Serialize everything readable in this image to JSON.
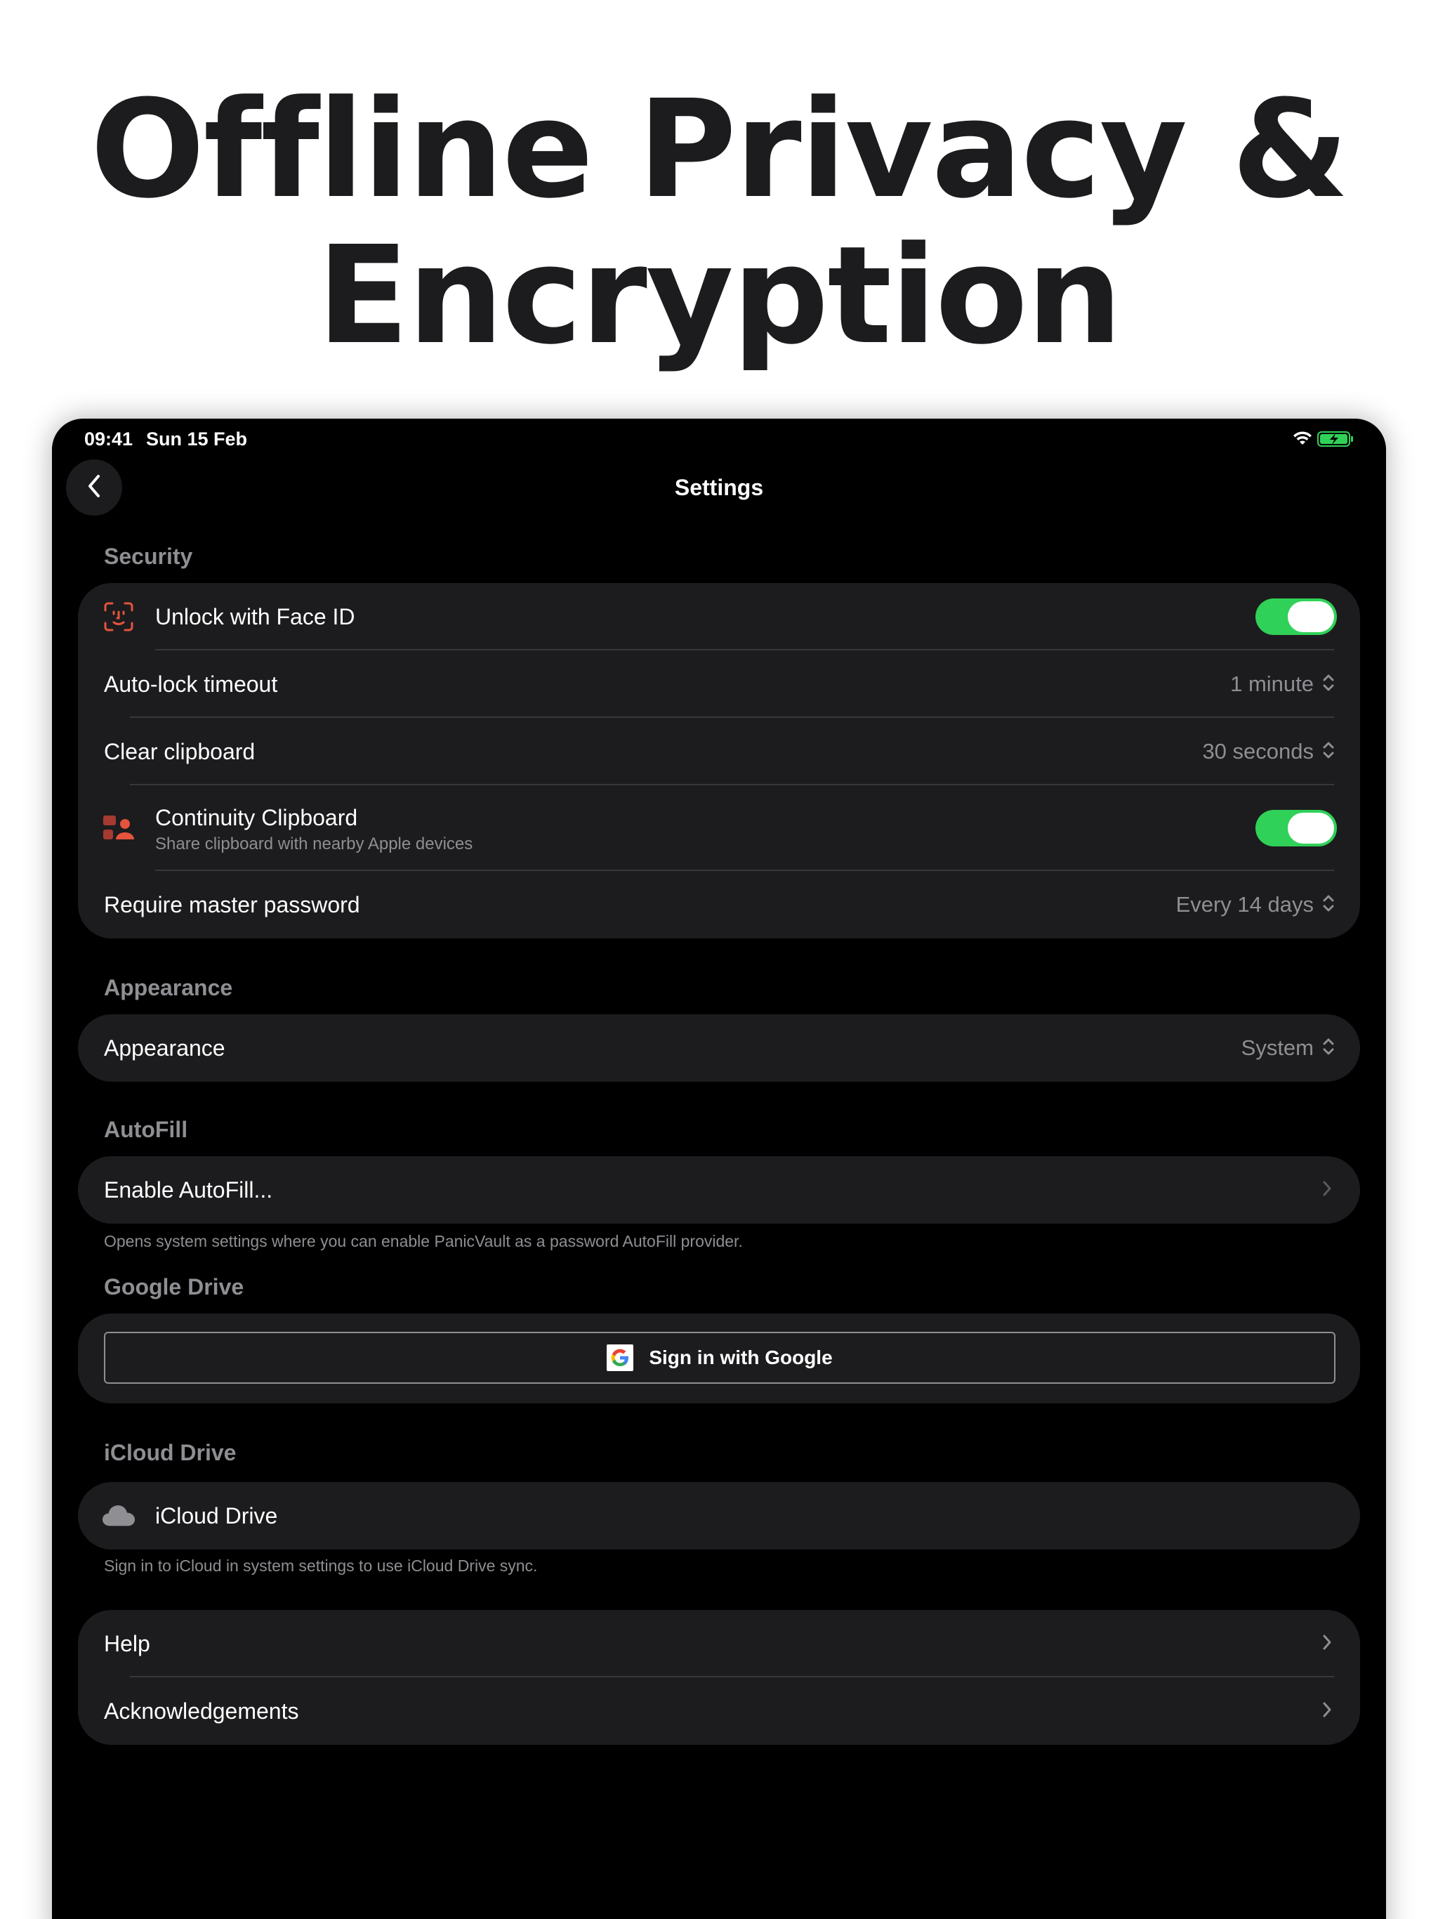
{
  "headline": {
    "line1": "Offline Privacy &",
    "line2": "Encryption"
  },
  "status_bar": {
    "time": "09:41",
    "date": "Sun 15 Feb",
    "battery_state": "charging"
  },
  "nav": {
    "title": "Settings",
    "back_icon": "chevron-left-icon"
  },
  "sections": {
    "security": {
      "label": "Security",
      "face_id": {
        "label": "Unlock with Face ID",
        "enabled": true,
        "icon": "face-id-icon"
      },
      "auto_lock": {
        "label": "Auto-lock timeout",
        "value": "1 minute"
      },
      "clear_clipboard": {
        "label": "Clear clipboard",
        "value": "30 seconds"
      },
      "continuity": {
        "label": "Continuity Clipboard",
        "subtitle": "Share clipboard with nearby Apple devices",
        "enabled": true,
        "icon": "continuity-icon"
      },
      "master_password": {
        "label": "Require master password",
        "value": "Every 14 days"
      }
    },
    "appearance": {
      "label": "Appearance",
      "row": {
        "label": "Appearance",
        "value": "System"
      }
    },
    "autofill": {
      "label": "AutoFill",
      "row": {
        "label": "Enable AutoFill..."
      },
      "footnote": "Opens system settings where you can enable PanicVault as a password AutoFill provider."
    },
    "google_drive": {
      "label": "Google Drive",
      "button": "Sign in with Google"
    },
    "icloud": {
      "label": "iCloud Drive",
      "row": {
        "label": "iCloud Drive",
        "icon": "cloud-icon"
      },
      "footnote": "Sign in to iCloud in system settings to use iCloud Drive sync."
    },
    "misc": {
      "help": "Help",
      "acknowledgements": "Acknowledgements"
    }
  },
  "colors": {
    "toggle_on": "#30d158",
    "background": "#000000",
    "cell": "#1c1c1e",
    "secondary_text": "#8e8e93",
    "icon_accent": "#e5533d"
  }
}
